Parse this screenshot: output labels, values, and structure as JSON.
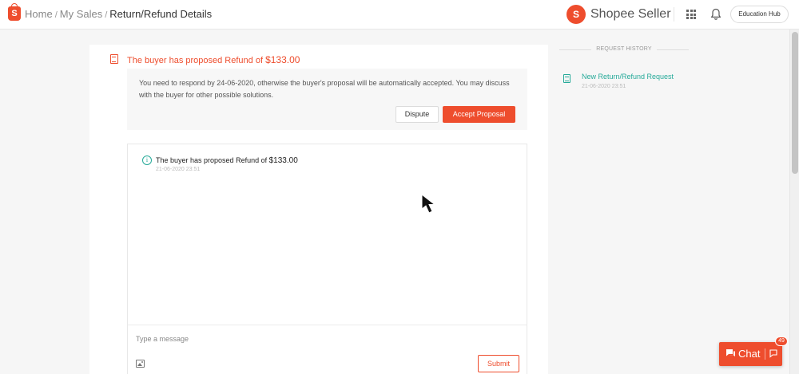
{
  "header": {
    "logo_letter": "S",
    "breadcrumb": [
      {
        "label": "Home"
      },
      {
        "label": "My Sales"
      },
      {
        "label": "Return/Refund Details"
      }
    ],
    "separator": "/",
    "brand_logo_letter": "S",
    "brand_name": "Shopee Seller",
    "education_hub_label": "Education Hub"
  },
  "proposal": {
    "title_prefix": "The buyer has proposed Refund of",
    "amount": "$133.00",
    "notice": "You need to respond by 24-06-2020, otherwise the buyer's proposal will be automatically accepted. You may discuss with the buyer for other possible solutions.",
    "dispute_label": "Dispute",
    "accept_label": "Accept Proposal"
  },
  "chat_panel": {
    "message_prefix": "The buyer has proposed Refund of",
    "message_amount": "$133.00",
    "message_time": "21-06-2020 23:51",
    "input_placeholder": "Type a message",
    "submit_label": "Submit"
  },
  "request_history": {
    "heading": "REQUEST HISTORY",
    "items": [
      {
        "title": "New Return/Refund Request",
        "time": "21-06-2020 23:51"
      }
    ]
  },
  "chat_widget": {
    "label": "Chat",
    "badge_count": "49"
  },
  "colors": {
    "brand": "#ee4d2d",
    "accent_teal": "#26aa99"
  },
  "icons": [
    "shopee-bag-icon",
    "apps-grid-icon",
    "bell-icon",
    "document-icon",
    "info-icon",
    "image-icon",
    "chat-bubble-icon",
    "chat-expand-icon",
    "mouse-cursor-icon"
  ]
}
